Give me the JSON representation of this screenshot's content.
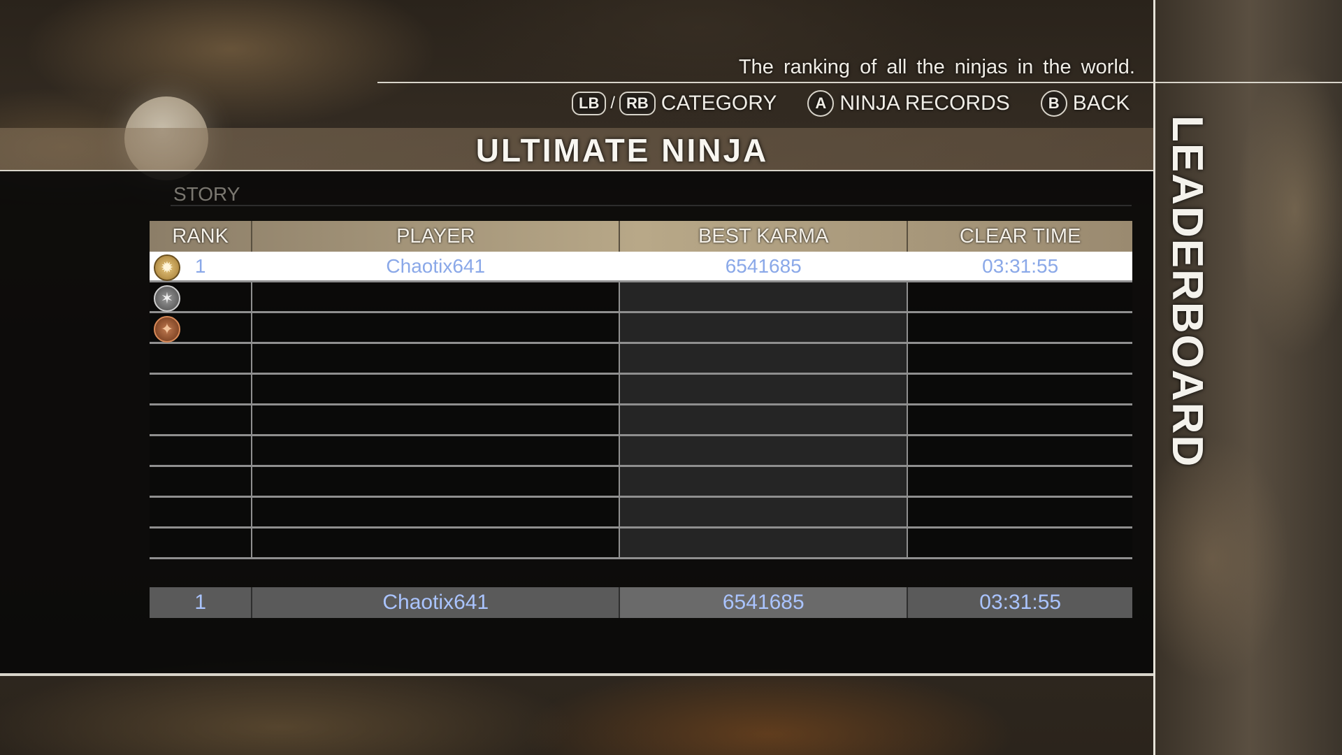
{
  "subtitle": "The ranking of all the ninjas in the world.",
  "controls": {
    "lb": "LB",
    "separator": "/",
    "rb": "RB",
    "category_label": "CATEGORY",
    "a_button": "A",
    "ninja_records_label": "NINJA RECORDS",
    "b_button": "B",
    "back_label": "BACK"
  },
  "page_title": "ULTIMATE NINJA",
  "side_title": "LEADERBOARD",
  "story_label": "STORY",
  "table": {
    "headers": {
      "rank": "RANK",
      "player": "PLAYER",
      "karma": "BEST KARMA",
      "time": "CLEAR TIME"
    },
    "rows": [
      {
        "rank": "1",
        "player": "Chaotix641",
        "karma": "6541685",
        "time": "03:31:55",
        "medal": "gold-medal"
      },
      {
        "rank": "",
        "player": "",
        "karma": "",
        "time": "",
        "medal": "silver-medal"
      },
      {
        "rank": "",
        "player": "",
        "karma": "",
        "time": "",
        "medal": "bronze-medal"
      },
      {
        "rank": "",
        "player": "",
        "karma": "",
        "time": ""
      },
      {
        "rank": "",
        "player": "",
        "karma": "",
        "time": ""
      },
      {
        "rank": "",
        "player": "",
        "karma": "",
        "time": ""
      },
      {
        "rank": "",
        "player": "",
        "karma": "",
        "time": ""
      },
      {
        "rank": "",
        "player": "",
        "karma": "",
        "time": ""
      },
      {
        "rank": "",
        "player": "",
        "karma": "",
        "time": ""
      },
      {
        "rank": "",
        "player": "",
        "karma": "",
        "time": ""
      }
    ]
  },
  "player_row": {
    "rank": "1",
    "player": "Chaotix641",
    "karma": "6541685",
    "time": "03:31:55"
  }
}
